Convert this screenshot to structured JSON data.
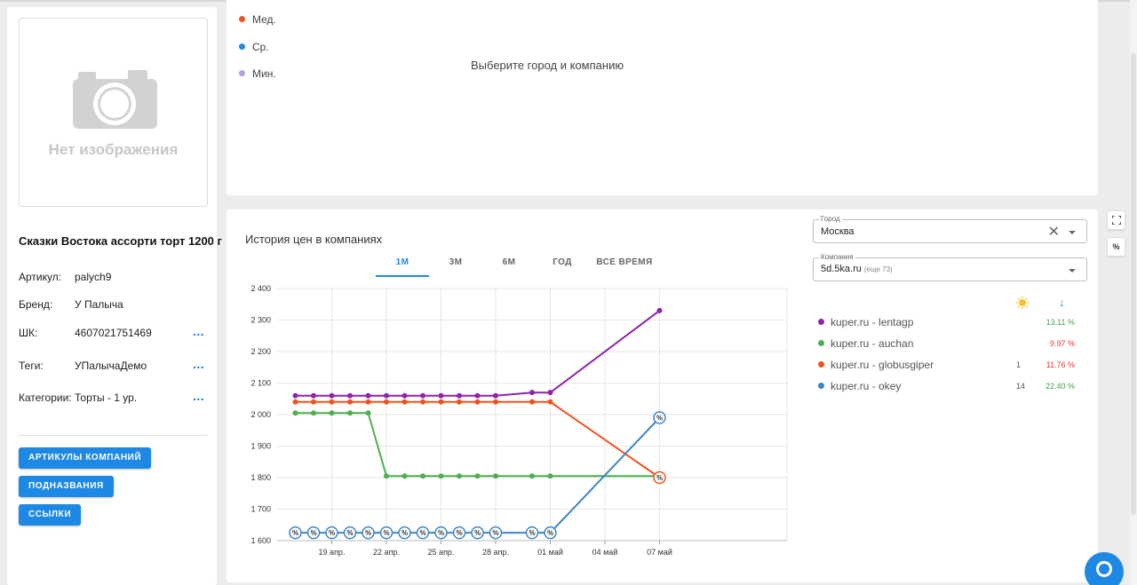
{
  "product": {
    "no_image_text": "Нет изображения",
    "title": "Сказки Востока ассорти торт 1200 г",
    "props": [
      {
        "key": "Артикул:",
        "value": "palych9",
        "more": ""
      },
      {
        "key": "Бренд:",
        "value": "У Палыча",
        "more": ""
      },
      {
        "key": "ШК:",
        "value": "4607021751469",
        "more": "..."
      },
      {
        "key": "Теги:",
        "value": "УПалычаДемо",
        "more": "..."
      },
      {
        "key": "Категории:",
        "value": "Торты - 1 ур.",
        "more": "..."
      }
    ],
    "buttons": {
      "articles": "АРТИКУЛЫ КОМПАНИЙ",
      "subnames": "ПОДНАЗВАНИЯ",
      "links": "ССЫЛКИ"
    }
  },
  "top_panel": {
    "legend": [
      {
        "label": "Мед.",
        "color": "#f4511e"
      },
      {
        "label": "Ср.",
        "color": "#1e88e5"
      },
      {
        "label": "Мин.",
        "color": "#b39ddb"
      }
    ],
    "empty_message": "Выберите город и компанию"
  },
  "history": {
    "title": "История цен в компаниях",
    "tabs": [
      {
        "label": "1М",
        "active": true
      },
      {
        "label": "3М",
        "active": false
      },
      {
        "label": "6М",
        "active": false
      },
      {
        "label": "ГОД",
        "active": false
      },
      {
        "label": "ВСЕ ВРЕМЯ",
        "active": false
      }
    ]
  },
  "filters": {
    "city_label": "Город",
    "city_value": "Москва",
    "company_label": "Компания",
    "company_value": "5d.5ka.ru",
    "company_extra": "(еще 73)"
  },
  "companies_header": {
    "sun_icon": "sun-icon",
    "sort_icon": "arrow-down-icon"
  },
  "companies": [
    {
      "name": "kuper.ru - lentagp",
      "color": "#8e24aa",
      "count": "",
      "pct": "13.11 %",
      "pct_color": "#43a047"
    },
    {
      "name": "kuper.ru - auchan",
      "color": "#4caf50",
      "count": "",
      "pct": "9.97 %",
      "pct_color": "#e53935"
    },
    {
      "name": "kuper.ru - globusgiper",
      "color": "#f4511e",
      "count": "1",
      "pct": "11.76 %",
      "pct_color": "#e53935"
    },
    {
      "name": "kuper.ru - okey",
      "color": "#3d85c6",
      "count": "14",
      "pct": "22.40 %",
      "pct_color": "#43a047"
    }
  ],
  "side_buttons": {
    "fullscreen_icon": "fullscreen-icon",
    "percent": "%"
  },
  "chat_icon": "chat-icon",
  "chart_data": {
    "type": "line",
    "title": "История цен в компаниях",
    "x_ticks": [
      "19 апр.",
      "22 апр.",
      "25 апр.",
      "28 апр.",
      "01 май",
      "04 май",
      "07 май"
    ],
    "y_ticks": [
      "1 600",
      "1 700",
      "1 800",
      "1 900",
      "2 000",
      "2 100",
      "2 200",
      "2 300",
      "2 400"
    ],
    "ylim": [
      1600,
      2400
    ],
    "x_range": [
      16,
      44
    ],
    "grid": true,
    "x_note": "x values are days counted from 1 апр. (01 май = 31)",
    "series": [
      {
        "name": "kuper.ru - lentagp",
        "color": "#8e24aa",
        "x": [
          17,
          18,
          19,
          20,
          21,
          22,
          23,
          24,
          25,
          26,
          27,
          28,
          30,
          31,
          37
        ],
        "values": [
          2060,
          2060,
          2060,
          2060,
          2060,
          2060,
          2060,
          2060,
          2060,
          2060,
          2060,
          2060,
          2070,
          2070,
          2330
        ],
        "promo_markers": []
      },
      {
        "name": "kuper.ru - auchan",
        "color": "#4caf50",
        "x": [
          17,
          18,
          19,
          20,
          21,
          22,
          23,
          24,
          25,
          26,
          27,
          28,
          30,
          31,
          37
        ],
        "values": [
          2005,
          2005,
          2005,
          2005,
          2005,
          1805,
          1805,
          1805,
          1805,
          1805,
          1805,
          1805,
          1805,
          1805,
          1805
        ],
        "promo_markers": []
      },
      {
        "name": "kuper.ru - globusgiper",
        "color": "#f4511e",
        "x": [
          17,
          18,
          19,
          20,
          21,
          22,
          23,
          24,
          25,
          26,
          27,
          28,
          30,
          31,
          37
        ],
        "values": [
          2040,
          2040,
          2040,
          2040,
          2040,
          2040,
          2040,
          2040,
          2040,
          2040,
          2040,
          2040,
          2040,
          2040,
          1800
        ],
        "promo_markers": [
          37
        ]
      },
      {
        "name": "kuper.ru - okey",
        "color": "#3d85c6",
        "x": [
          17,
          18,
          19,
          20,
          21,
          22,
          23,
          24,
          25,
          26,
          27,
          28,
          30,
          31,
          37
        ],
        "values": [
          1625,
          1625,
          1625,
          1625,
          1625,
          1625,
          1625,
          1625,
          1625,
          1625,
          1625,
          1625,
          1625,
          1625,
          1990
        ],
        "promo_markers": [
          17,
          18,
          19,
          20,
          21,
          22,
          23,
          24,
          25,
          26,
          27,
          28,
          30,
          31,
          37
        ]
      }
    ]
  }
}
